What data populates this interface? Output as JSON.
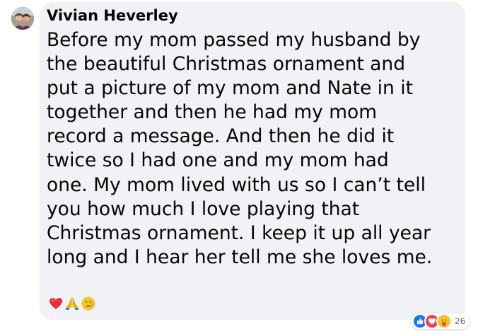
{
  "comment": {
    "author": "Vivian Heverley",
    "text_lines": [
      "Before my mom passed my husband by",
      "the beautiful Christmas ornament and",
      "put a picture of my mom and Nate in it",
      "together and then he had my mom",
      "record a message. And then he did it",
      "twice so I had one and my mom had",
      "one. My mom lived with us so I can’t tell",
      "you how much I love playing that",
      "Christmas ornament. I keep it up all year",
      "long and I hear her tell me she loves me."
    ],
    "inline_emojis": [
      "red-heart-icon",
      "folded-hands-icon",
      "crying-face-icon"
    ]
  },
  "reactions": {
    "icons": [
      "like-icon",
      "love-icon",
      "care-icon"
    ],
    "count": "26"
  },
  "colors": {
    "bubble_bg": "#f0f2f5",
    "text": "#050505",
    "meta_text": "#65676b",
    "like_blue": "#1877f2",
    "love_red": "#f33e58"
  }
}
